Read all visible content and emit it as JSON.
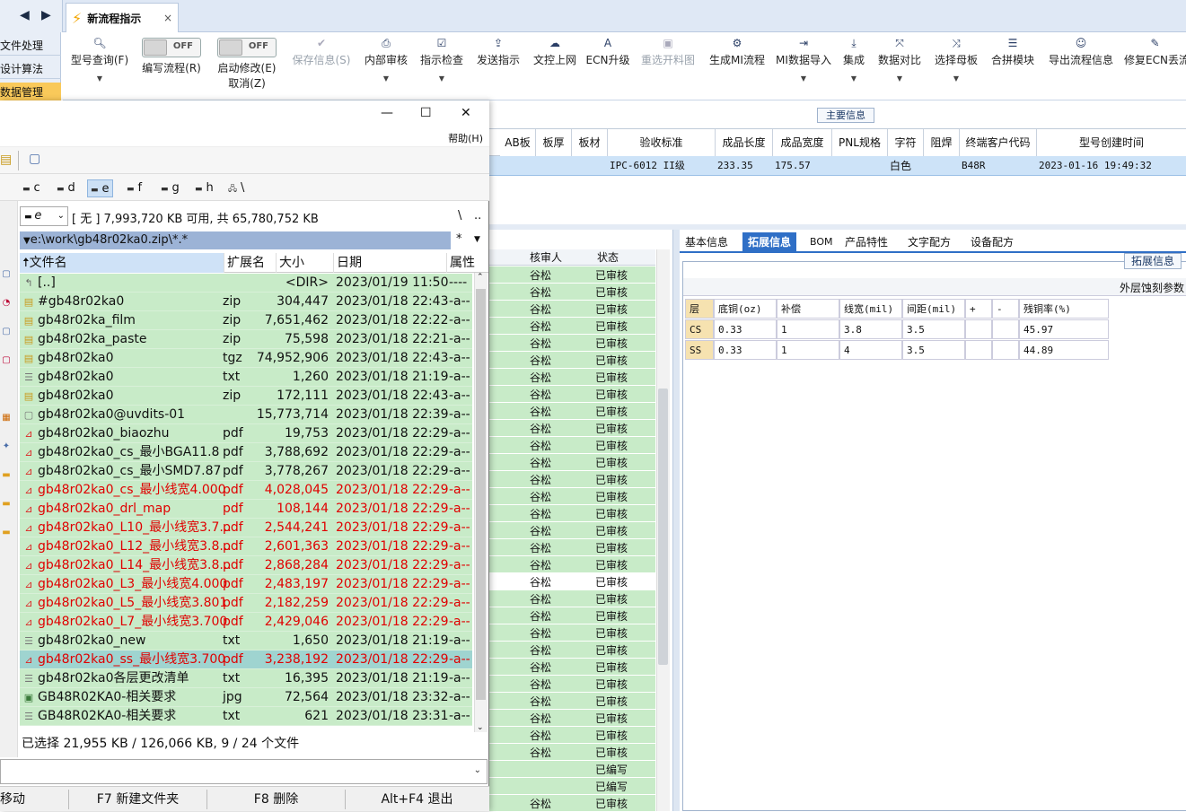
{
  "app": {
    "tab_title": "新流程指示",
    "tab_close": "×",
    "nav_back": "◀",
    "nav_forward": "▶"
  },
  "left_nav": [
    "文件处理",
    "设计算法",
    "数据管理"
  ],
  "ribbon": {
    "model_query": "型号查询(F)",
    "write_flow": "编写流程(R)",
    "enable_modify": "启动修改(E)",
    "cancel": "取消(Z)",
    "toggle_off": "OFF",
    "save_info": "保存信息(S)",
    "internal_review": "内部审核",
    "instruction_check": "指示检查",
    "send_instruction": "发送指示",
    "upload": "文控上网",
    "ecn_upgrade": "ECN升级",
    "reselect_cut": "重选开料图",
    "gen_mi": "生成MI流程",
    "mi_import": "MI数据导入",
    "integrate": "集成",
    "data_compare": "数据对比",
    "select_template": "选择母板",
    "merge_module": "合拼模块",
    "export_flow": "导出流程信息",
    "fix_ecn": "修复ECN丢流"
  },
  "main_info": {
    "section_title": "主要信息",
    "headers": [
      "AB板",
      "板厚",
      "板材",
      "验收标准",
      "成品长度",
      "成品宽度",
      "PNL规格",
      "字符",
      "阻焊",
      "终端客户代码",
      "型号创建时间"
    ],
    "row": {
      "standard": "IPC-6012 II级",
      "length": "233.35",
      "width": "175.57",
      "char": "白色",
      "customer": "B48R",
      "created": "2023-01-16 19:49:32"
    }
  },
  "review_list": {
    "headers": [
      "核审人",
      "状态"
    ],
    "rows": [
      [
        "谷松",
        "已审核"
      ],
      [
        "谷松",
        "已审核"
      ],
      [
        "谷松",
        "已审核"
      ],
      [
        "谷松",
        "已审核"
      ],
      [
        "谷松",
        "已审核"
      ],
      [
        "谷松",
        "已审核"
      ],
      [
        "谷松",
        "已审核"
      ],
      [
        "谷松",
        "已审核"
      ],
      [
        "谷松",
        "已审核"
      ],
      [
        "谷松",
        "已审核"
      ],
      [
        "谷松",
        "已审核"
      ],
      [
        "谷松",
        "已审核"
      ],
      [
        "谷松",
        "已审核"
      ],
      [
        "谷松",
        "已审核"
      ],
      [
        "谷松",
        "已审核"
      ],
      [
        "谷松",
        "已审核"
      ],
      [
        "谷松",
        "已审核"
      ],
      [
        "谷松",
        "已审核"
      ],
      [
        "谷松",
        "已审核"
      ],
      [
        "谷松",
        "已审核"
      ],
      [
        "谷松",
        "已审核"
      ],
      [
        "谷松",
        "已审核"
      ],
      [
        "谷松",
        "已审核"
      ],
      [
        "谷松",
        "已审核"
      ],
      [
        "谷松",
        "已审核"
      ],
      [
        "谷松",
        "已审核"
      ],
      [
        "谷松",
        "已审核"
      ],
      [
        "谷松",
        "已审核"
      ],
      [
        "谷松",
        "已审核"
      ],
      [
        "",
        "已编写"
      ],
      [
        "",
        "已编写"
      ],
      [
        "谷松",
        "已审核"
      ]
    ]
  },
  "right_tabs": [
    "基本信息",
    "拓展信息",
    "BOM",
    "产品特性",
    "文字配方",
    "设备配方"
  ],
  "ext": {
    "title": "拓展信息",
    "subtitle": "外层蚀刻参数",
    "headers": [
      "层",
      "底铜(oz)",
      "补偿",
      "线宽(mil)",
      "间距(mil)",
      "+",
      "-",
      "残铜率(%)"
    ],
    "rows": [
      [
        "CS",
        "0.33",
        "1",
        "3.8",
        "3.5",
        "",
        "",
        "45.97"
      ],
      [
        "SS",
        "0.33",
        "1",
        "4",
        "3.5",
        "",
        "",
        "44.89"
      ]
    ]
  },
  "dialog": {
    "help": "帮助(H)",
    "min": "—",
    "max": "☐",
    "close": "✕",
    "drives": [
      "c",
      "d",
      "e",
      "f",
      "g",
      "h",
      "\\"
    ],
    "drive_selected": "e",
    "drive_info": "[ 无 ]  7,993,720 KB 可用,  共 65,780,752 KB",
    "root_btn": "\\",
    "up_btn": "..",
    "path": "e:\\work\\gb48r02ka0.zip\\*.*",
    "path_star": "*",
    "col_name": "文件名",
    "col_ext": "扩展名",
    "col_size": "大小",
    "col_date": "日期",
    "col_attr": "属性",
    "files": [
      {
        "name": "[..]",
        "ext": "",
        "size": "<DIR>",
        "date": "2023/01/19 11:50",
        "attr": "----",
        "icon": "up",
        "red": false
      },
      {
        "name": "#gb48r02ka0",
        "ext": "zip",
        "size": "304,447",
        "date": "2023/01/18 22:43",
        "attr": "-a--",
        "icon": "zip",
        "red": false
      },
      {
        "name": "gb48r02ka_film",
        "ext": "zip",
        "size": "7,651,462",
        "date": "2023/01/18 22:22",
        "attr": "-a--",
        "icon": "zip",
        "red": false
      },
      {
        "name": "gb48r02ka_paste",
        "ext": "zip",
        "size": "75,598",
        "date": "2023/01/18 22:21",
        "attr": "-a--",
        "icon": "zip",
        "red": false
      },
      {
        "name": "gb48r02ka0",
        "ext": "tgz",
        "size": "74,952,906",
        "date": "2023/01/18 22:43",
        "attr": "-a--",
        "icon": "zip",
        "red": false
      },
      {
        "name": "gb48r02ka0",
        "ext": "txt",
        "size": "1,260",
        "date": "2023/01/18 21:19",
        "attr": "-a--",
        "icon": "txt",
        "red": false
      },
      {
        "name": "gb48r02ka0",
        "ext": "zip",
        "size": "172,111",
        "date": "2023/01/18 22:43",
        "attr": "-a--",
        "icon": "zip",
        "red": false
      },
      {
        "name": "gb48r02ka0@uvdits-01",
        "ext": "",
        "size": "15,773,714",
        "date": "2023/01/18 22:39",
        "attr": "-a--",
        "icon": "file",
        "red": false
      },
      {
        "name": "gb48r02ka0_biaozhu",
        "ext": "pdf",
        "size": "19,753",
        "date": "2023/01/18 22:29",
        "attr": "-a--",
        "icon": "pdf",
        "red": false
      },
      {
        "name": "gb48r02ka0_cs_最小BGA11.8",
        "ext": "pdf",
        "size": "3,788,692",
        "date": "2023/01/18 22:29",
        "attr": "-a--",
        "icon": "pdf",
        "red": false
      },
      {
        "name": "gb48r02ka0_cs_最小SMD7.87",
        "ext": "pdf",
        "size": "3,778,267",
        "date": "2023/01/18 22:29",
        "attr": "-a--",
        "icon": "pdf",
        "red": false
      },
      {
        "name": "gb48r02ka0_cs_最小线宽4.000",
        "ext": "pdf",
        "size": "4,028,045",
        "date": "2023/01/18 22:29",
        "attr": "-a--",
        "icon": "pdf",
        "red": true
      },
      {
        "name": "gb48r02ka0_drl_map",
        "ext": "pdf",
        "size": "108,144",
        "date": "2023/01/18 22:29",
        "attr": "-a--",
        "icon": "pdf",
        "red": true
      },
      {
        "name": "gb48r02ka0_L10_最小线宽3.7...",
        "ext": "pdf",
        "size": "2,544,241",
        "date": "2023/01/18 22:29",
        "attr": "-a--",
        "icon": "pdf",
        "red": true
      },
      {
        "name": "gb48r02ka0_L12_最小线宽3.8...",
        "ext": "pdf",
        "size": "2,601,363",
        "date": "2023/01/18 22:29",
        "attr": "-a--",
        "icon": "pdf",
        "red": true
      },
      {
        "name": "gb48r02ka0_L14_最小线宽3.8...",
        "ext": "pdf",
        "size": "2,868,284",
        "date": "2023/01/18 22:29",
        "attr": "-a--",
        "icon": "pdf",
        "red": true
      },
      {
        "name": "gb48r02ka0_L3_最小线宽4.000",
        "ext": "pdf",
        "size": "2,483,197",
        "date": "2023/01/18 22:29",
        "attr": "-a--",
        "icon": "pdf",
        "red": true
      },
      {
        "name": "gb48r02ka0_L5_最小线宽3.801",
        "ext": "pdf",
        "size": "2,182,259",
        "date": "2023/01/18 22:29",
        "attr": "-a--",
        "icon": "pdf",
        "red": true
      },
      {
        "name": "gb48r02ka0_L7_最小线宽3.700",
        "ext": "pdf",
        "size": "2,429,046",
        "date": "2023/01/18 22:29",
        "attr": "-a--",
        "icon": "pdf",
        "red": true
      },
      {
        "name": "gb48r02ka0_new",
        "ext": "txt",
        "size": "1,650",
        "date": "2023/01/18 21:19",
        "attr": "-a--",
        "icon": "txt",
        "red": false
      },
      {
        "name": "gb48r02ka0_ss_最小线宽3.700",
        "ext": "pdf",
        "size": "3,238,192",
        "date": "2023/01/18 22:29",
        "attr": "-a--",
        "icon": "pdf",
        "red": true,
        "selected": true
      },
      {
        "name": "gb48r02ka0各层更改清单",
        "ext": "txt",
        "size": "16,395",
        "date": "2023/01/18 21:19",
        "attr": "-a--",
        "icon": "txt",
        "red": false
      },
      {
        "name": "GB48R02KA0-相关要求",
        "ext": "jpg",
        "size": "72,564",
        "date": "2023/01/18 23:32",
        "attr": "-a--",
        "icon": "img",
        "red": false
      },
      {
        "name": "GB48R02KA0-相关要求",
        "ext": "txt",
        "size": "621",
        "date": "2023/01/18 23:31",
        "attr": "-a--",
        "icon": "txt",
        "red": false
      }
    ],
    "status": "已选择 21,955 KB / 126,066 KB,   9 / 24 个文件",
    "fkeys": [
      "移动",
      "F7 新建文件夹",
      "F8 删除",
      "Alt+F4 退出"
    ]
  },
  "colors": {
    "accent": "#2f6fc6",
    "row_green": "#c8ebc8",
    "red_text": "#e00000",
    "nav_selected": "#f9c95a"
  }
}
